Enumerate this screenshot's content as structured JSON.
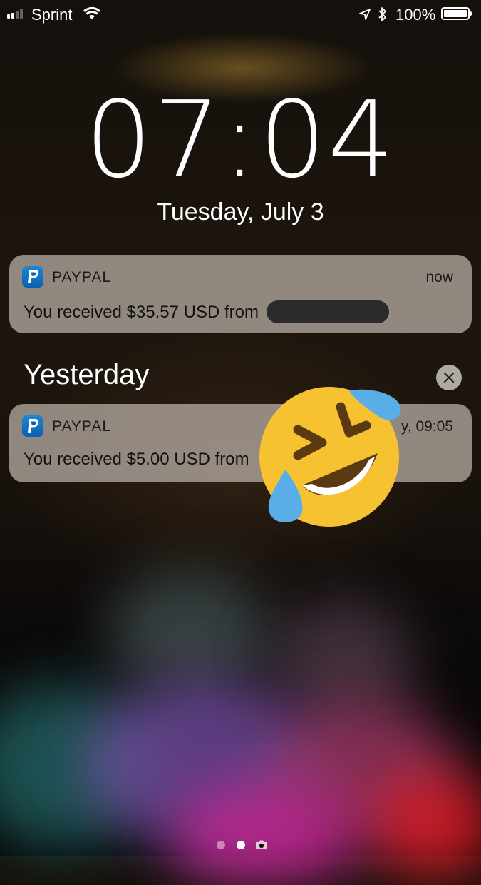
{
  "status_bar": {
    "carrier": "Sprint",
    "battery": "100%",
    "icons": [
      "signal-icon",
      "wifi-icon",
      "location-arrow-icon",
      "bluetooth-icon",
      "battery-icon"
    ]
  },
  "lock_screen": {
    "time": "07:04",
    "date": "Tuesday, July 3"
  },
  "notifications": {
    "current": {
      "app": "PAYPAL",
      "time": "now",
      "message": "You received $35.57 USD from"
    },
    "section_title": "Yesterday",
    "yesterday": {
      "app": "PAYPAL",
      "time": "y, 09:05",
      "message": "You received $5.00 USD from"
    }
  },
  "overlay": {
    "emoji": "rolling-on-floor-laughing-emoji"
  },
  "page_indicator": {
    "pages": 3,
    "active": 2
  },
  "colors": {
    "paypal_blue": "#0a5fb0",
    "card": "#bdb4ac"
  }
}
